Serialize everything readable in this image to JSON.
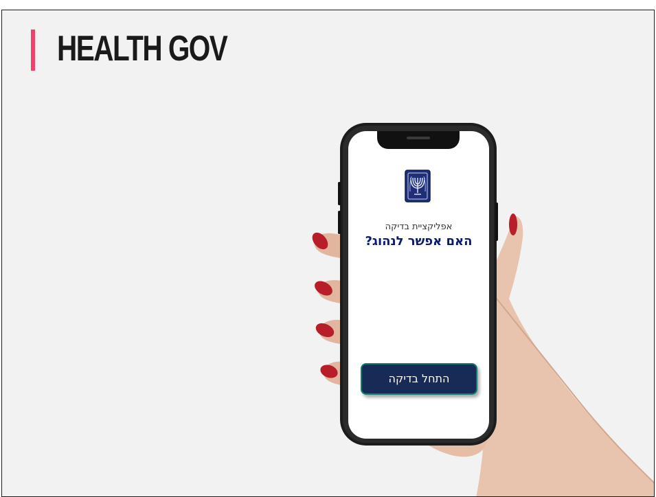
{
  "header": {
    "title": "HEALTH GOV",
    "accent_color": "#f0426a"
  },
  "app": {
    "subtitle": "אפליקציית בדיקה",
    "heading": "האם אפשר לנהוג?",
    "start_button_label": "התחל בדיקה",
    "emblem_icon": "state-emblem-icon",
    "brand_color": "#0a1a70",
    "button_color": "#182a56"
  }
}
